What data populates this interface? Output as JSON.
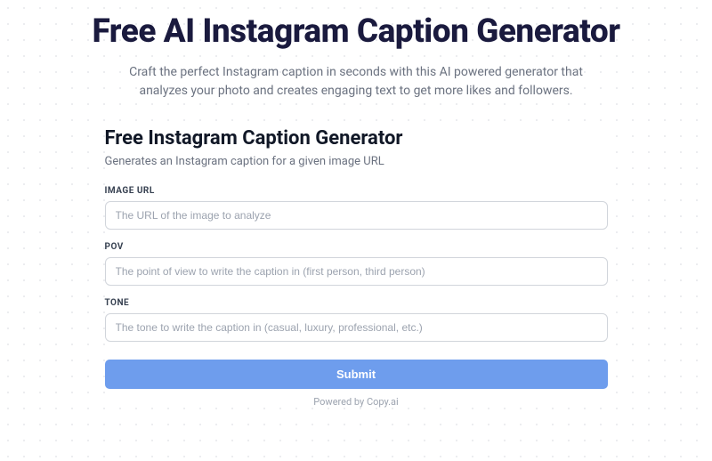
{
  "header": {
    "title": "Free AI Instagram Caption Generator",
    "subtitle": "Craft the perfect Instagram caption in seconds with this AI powered generator that analyzes your photo and creates engaging text to get more likes and followers."
  },
  "form": {
    "title": "Free Instagram Caption Generator",
    "description": "Generates an Instagram caption for a given image URL",
    "fields": {
      "image_url": {
        "label": "IMAGE URL",
        "placeholder": "The URL of the image to analyze"
      },
      "pov": {
        "label": "POV",
        "placeholder": "The point of view to write the caption in (first person, third person)"
      },
      "tone": {
        "label": "TONE",
        "placeholder": "The tone to write the caption in (casual, luxury, professional, etc.)"
      }
    },
    "submit_label": "Submit",
    "powered_by": "Powered by Copy.ai"
  }
}
